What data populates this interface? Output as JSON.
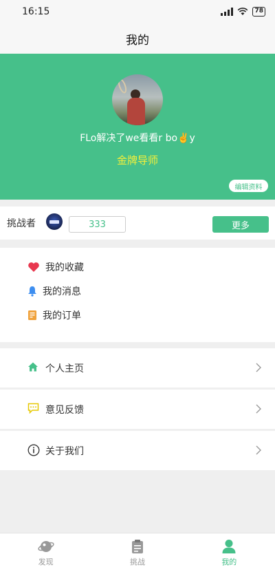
{
  "status_bar": {
    "time": "16:15",
    "battery": "78"
  },
  "nav": {
    "title": "我的"
  },
  "profile": {
    "name": "FLo解决了we看看r bo✌️y",
    "title": "金牌导师",
    "edit_label": "编辑资料"
  },
  "challenger": {
    "label": "挑战者",
    "value": "333",
    "more_label": "更多"
  },
  "quick_links": [
    {
      "label": "我的收藏",
      "icon": "heart-icon"
    },
    {
      "label": "我的消息",
      "icon": "bell-icon"
    },
    {
      "label": "我的订单",
      "icon": "order-icon"
    }
  ],
  "menu": [
    {
      "label": "个人主页",
      "icon": "home-icon"
    },
    {
      "label": "意见反馈",
      "icon": "feedback-icon"
    },
    {
      "label": "关于我们",
      "icon": "info-icon"
    }
  ],
  "tabs": [
    {
      "label": "发现",
      "icon": "planet-icon",
      "active": false
    },
    {
      "label": "挑战",
      "icon": "clipboard-icon",
      "active": false
    },
    {
      "label": "我的",
      "icon": "user-icon",
      "active": true
    }
  ],
  "colors": {
    "accent": "#46c08a",
    "title_yellow": "#f4ef3a",
    "heart": "#e8384f",
    "bell": "#3d8ef0",
    "order": "#f0a23c"
  }
}
